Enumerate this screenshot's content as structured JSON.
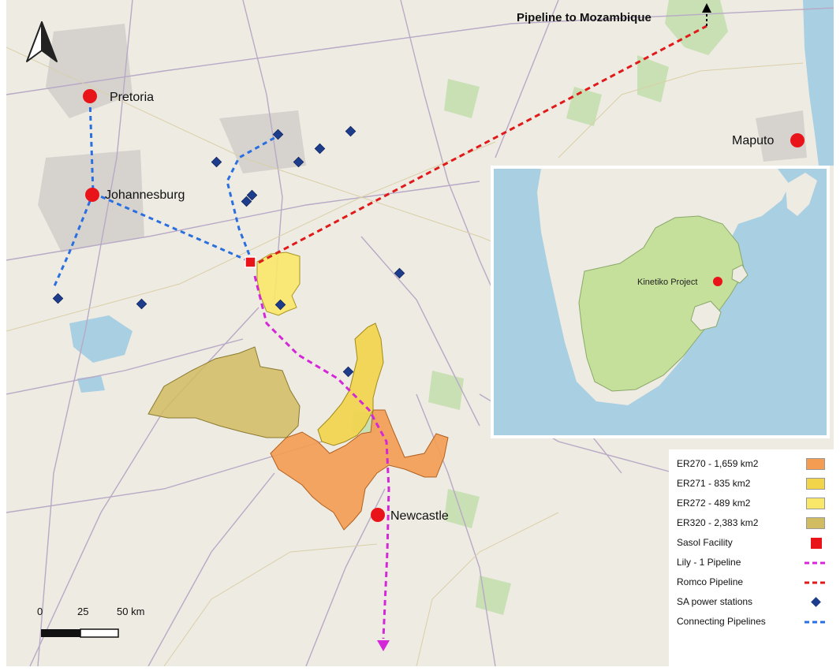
{
  "map": {
    "pipeline_title": "Pipeline to Mozambique",
    "cities": [
      {
        "name": "Pretoria"
      },
      {
        "name": "Johannesburg"
      },
      {
        "name": "Maputo"
      },
      {
        "name": "Newcastle"
      }
    ],
    "inset_label": "Kinetiko Project",
    "scale": {
      "t0": "0",
      "t1": "25",
      "t2": "50 km"
    }
  },
  "legend": {
    "items": [
      {
        "label": "ER270 - 1,659 km2",
        "color": "#f39c52"
      },
      {
        "label": "ER271 - 835 km2",
        "color": "#f2d44a"
      },
      {
        "label": "ER272 - 489 km2",
        "color": "#f9e76a"
      },
      {
        "label": "ER320 - 2,383 km2",
        "color": "#d1bc61"
      },
      {
        "label": "Sasol Facility",
        "color": "#e8141a"
      },
      {
        "label": "Lily - 1 Pipeline",
        "color": "#d428d8"
      },
      {
        "label": "Romco Pipeline",
        "color": "#e01a1a"
      },
      {
        "label": "SA power stations",
        "color": "#1e3c8c"
      },
      {
        "label": "Connecting Pipelines",
        "color": "#2a6fdf"
      }
    ]
  }
}
